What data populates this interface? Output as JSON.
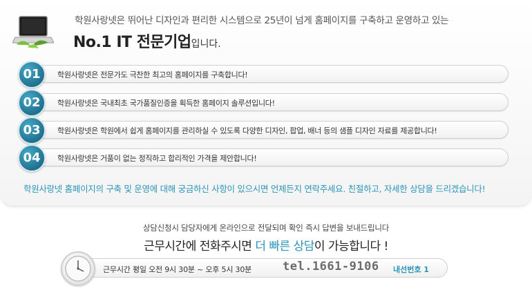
{
  "intro": {
    "line1": "학원사랑넷은 뛰어난 디자인과 편리한 시스템으로 25년이 넘게 홈페이지를 구축하고 운영하고 있는",
    "headline_big": "No.1 IT 전문기업",
    "headline_suffix": "입니다."
  },
  "items": [
    {
      "number": "01",
      "text": "학원사랑넷은 전문가도 극찬한 최고의 홈페이지를 구축합니다!"
    },
    {
      "number": "02",
      "text": "학원사랑넷은 국내최초 국가품질인증을 획득한 홈페이지 솔루션입니다!"
    },
    {
      "number": "03",
      "text": "학원사랑넷은 학원에서 쉽게 홈페이지를 관리하실 수 있도록 다양한 디자인, 팝업, 배너 등의 샘플 디자인 자료를 제공합니다!"
    },
    {
      "number": "04",
      "text": "학원사랑넷은 거품이 없는 정직하고 합리적인 가격을 제안합니다!"
    }
  ],
  "cta": "학원사랑넷 홈페이지의 구축 및 운영에 대해 궁금하신 사항이 있으시면 언제든지 연락주세요. 친절하고, 자세한 상담을 드리겠습니다!",
  "contact": {
    "notice": "상담신청시 담당자에게 온라인으로 전달되며 확인 즉시 답변을 보내드립니다",
    "tagline_pre": "근무시간에 전화주시면 ",
    "tagline_highlight": "더 빠른 상담",
    "tagline_post": "이 가능합니다 !",
    "hours": "근무시간 평일 오전 9시 30분 ~ 오후 5시 30분",
    "tel": "tel.1661-9106",
    "extension": "내선번호 1"
  },
  "colors": {
    "accent": "#2a94b7",
    "badge": "#1e6e8d",
    "laptop_screen": "#1a1a1a"
  },
  "icons": [
    "laptop-icon",
    "clock-icon"
  ]
}
